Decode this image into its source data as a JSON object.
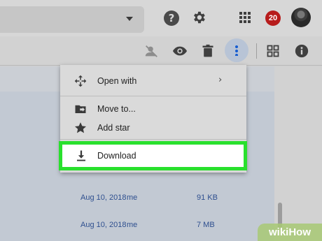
{
  "header": {
    "help_glyph": "?",
    "notifications_count": "20",
    "icons": [
      "search-dropdown-icon",
      "help-icon",
      "gear-icon",
      "apps-grid-icon",
      "notifications-badge",
      "avatar"
    ]
  },
  "toolbar": {
    "icons": [
      "share-person-off-icon",
      "preview-eye-icon",
      "trash-icon",
      "more-vertical-icon",
      "grid-view-icon",
      "info-icon"
    ],
    "more_active_color": "#1a5fd0"
  },
  "menu": {
    "items": [
      {
        "label": "Open with",
        "icon": "move-arrows-icon",
        "has_submenu": true
      },
      {
        "label": "Move to...",
        "icon": "folder-move-icon"
      },
      {
        "label": "Add star",
        "icon": "star-icon"
      },
      {
        "label": "Download",
        "icon": "download-icon",
        "highlighted": true
      }
    ],
    "highlight_color": "#29e02d"
  },
  "files": [
    {
      "date": "Aug 10, 2018",
      "owner": "me",
      "size": "91 KB"
    },
    {
      "date": "Aug 10, 2018",
      "owner": "me",
      "size": "7 MB"
    }
  ],
  "watermark": {
    "part1": "wiki",
    "part2": "How"
  }
}
